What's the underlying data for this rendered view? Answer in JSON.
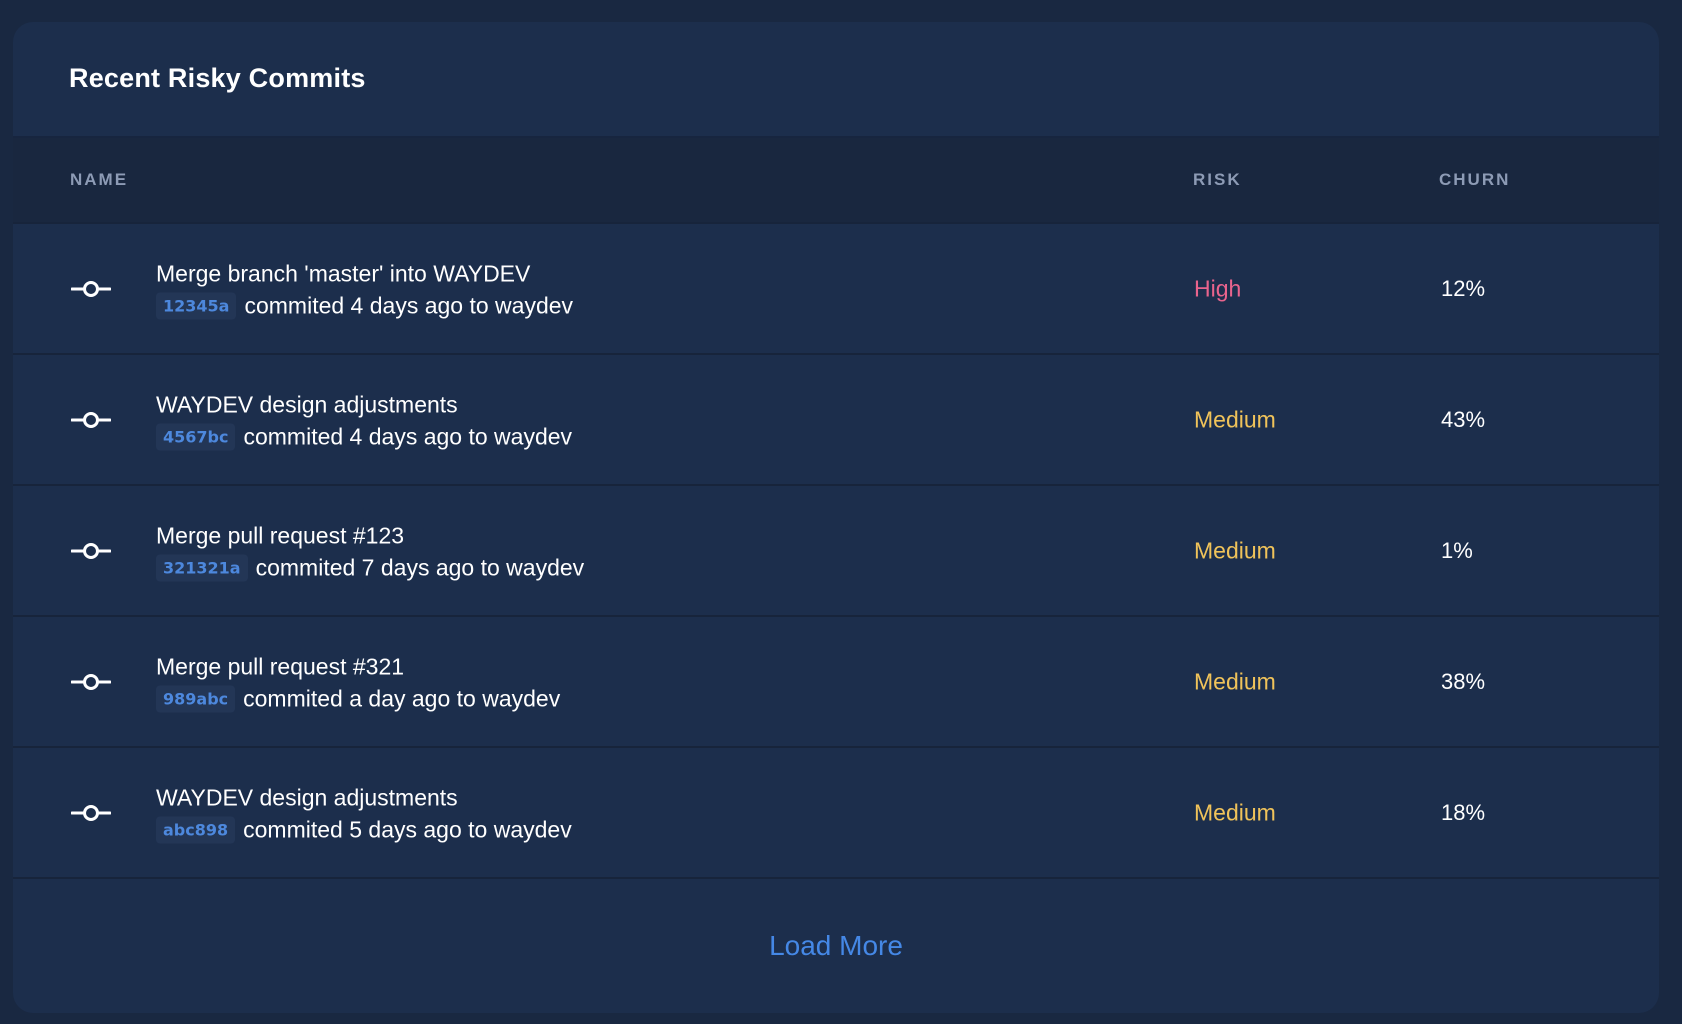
{
  "card": {
    "title": "Recent Risky Commits"
  },
  "table": {
    "headers": {
      "name": "NAME",
      "risk": "RISK",
      "churn": "CHURN"
    },
    "rows": [
      {
        "title": "Merge branch 'master' into WAYDEV",
        "hash": "12345a",
        "meta": "commited 4 days ago to waydev",
        "risk": "High",
        "risk_level": "high",
        "churn": "12%"
      },
      {
        "title": "WAYDEV design adjustments",
        "hash": "4567bc",
        "meta": "commited 4 days ago to waydev",
        "risk": "Medium",
        "risk_level": "medium",
        "churn": "43%"
      },
      {
        "title": "Merge pull request #123",
        "hash": "321321a",
        "meta": "commited 7 days ago to waydev",
        "risk": "Medium",
        "risk_level": "medium",
        "churn": "1%"
      },
      {
        "title": "Merge pull request #321",
        "hash": "989abc",
        "meta": "commited a day ago to waydev",
        "risk": "Medium",
        "risk_level": "medium",
        "churn": "38%"
      },
      {
        "title": "WAYDEV design adjustments",
        "hash": "abc898",
        "meta": "commited 5 days ago to waydev",
        "risk": "Medium",
        "risk_level": "medium",
        "churn": "18%"
      }
    ]
  },
  "footer": {
    "load_more_label": "Load More"
  },
  "colors": {
    "risk_high": "#e9648d",
    "risk_medium": "#f0c35a",
    "accent": "#4588e6"
  },
  "icons": {
    "row_icon": "commit-icon"
  }
}
